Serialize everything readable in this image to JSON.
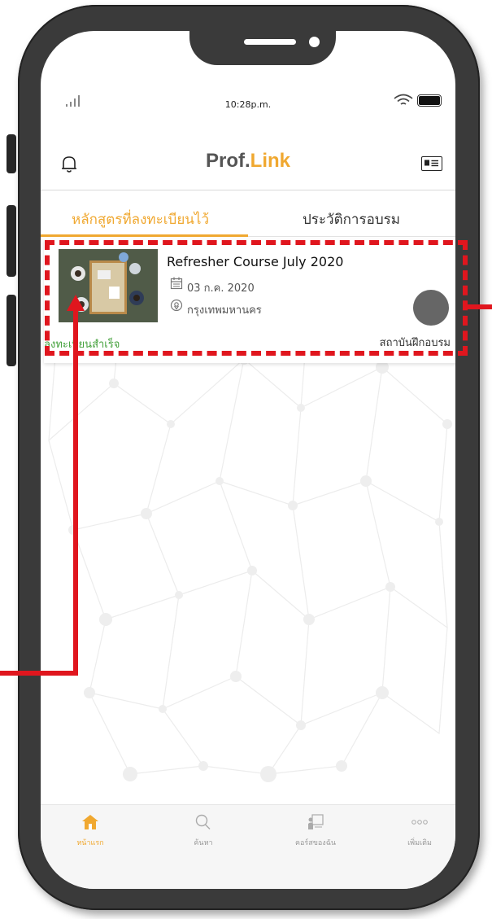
{
  "status_bar": {
    "time": "10:28p.m."
  },
  "header": {
    "logo_main": "Prof.",
    "logo_accent": "Link"
  },
  "tabs": [
    {
      "label": "หลักสูตรที่ลงทะเบียนไว้",
      "active": true
    },
    {
      "label": "ประวัติการอบรม",
      "active": false
    }
  ],
  "course": {
    "title": "Refresher Course July 2020",
    "date": "03 ก.ค. 2020",
    "location": "กรุงเทพมหานคร",
    "institute": "สถาบันฝึกอบรม",
    "status": "ลงทะเบียนสำเร็จ"
  },
  "bottom_nav": [
    {
      "label": "หน้าแรก",
      "icon": "home-icon",
      "active": true
    },
    {
      "label": "ค้นหา",
      "icon": "search-icon",
      "active": false
    },
    {
      "label": "คอร์สของฉัน",
      "icon": "my-course-icon",
      "active": false
    },
    {
      "label": "เพิ่มเติม",
      "icon": "more-icon",
      "active": false
    }
  ],
  "colors": {
    "accent": "#f0a830",
    "success": "#44a13c",
    "annotation": "#e0161e"
  }
}
